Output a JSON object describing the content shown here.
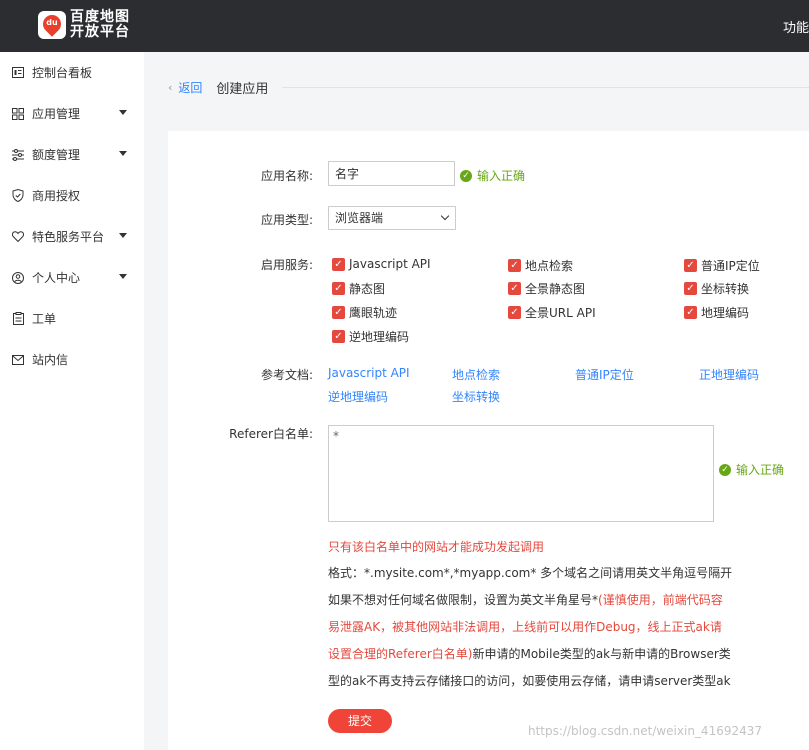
{
  "header": {
    "logo_badge": "du",
    "logo_line1": "百度地图",
    "logo_line2": "开放平台",
    "right_text": "功能"
  },
  "sidebar": {
    "items": [
      {
        "label": "控制台看板",
        "icon": "dashboard-icon",
        "caret": false
      },
      {
        "label": "应用管理",
        "icon": "grid-icon",
        "caret": true
      },
      {
        "label": "额度管理",
        "icon": "sliders-icon",
        "caret": true
      },
      {
        "label": "商用授权",
        "icon": "shield-icon",
        "caret": false
      },
      {
        "label": "特色服务平台",
        "icon": "heart-icon",
        "caret": true
      },
      {
        "label": "个人中心",
        "icon": "user-icon",
        "caret": true
      },
      {
        "label": "工单",
        "icon": "clipboard-icon",
        "caret": false
      },
      {
        "label": "站内信",
        "icon": "mail-icon",
        "caret": false
      }
    ]
  },
  "breadcrumb": {
    "back_label": "返回",
    "title": "创建应用"
  },
  "form": {
    "app_name_label": "应用名称:",
    "app_name_value": "名字",
    "valid_text": "输入正确",
    "app_type_label": "应用类型:",
    "app_type_value": "浏览器端",
    "services_label": "启用服务:",
    "services": [
      "Javascript API",
      "地点检索",
      "普通IP定位",
      "静态图",
      "全景静态图",
      "坐标转换",
      "鹰眼轨迹",
      "全景URL API",
      "地理编码",
      "逆地理编码"
    ],
    "docs_label": "参考文档:",
    "docs": [
      "Javascript API",
      "地点检索",
      "普通IP定位",
      "正地理编码",
      "逆地理编码",
      "坐标转换"
    ],
    "referer_label": "Referer白名单:",
    "referer_value": "*",
    "referer_valid_text": "输入正确",
    "warning": "只有该白名单中的网站才能成功发起调用",
    "format_line1": "格式：*.mysite.com*,*myapp.com* 多个域名之间请用英文半角逗号隔开",
    "format_line2a": "如果不想对任何域名做限制，设置为英文半角星号*",
    "format_line2b": "(谨慎使用，前端代码容",
    "format_line3": "易泄露AK，被其他网站非法调用，上线前可以用作Debug，线上正式ak请",
    "format_line4a": "设置合理的Referer白名单)",
    "format_line4b": "新申请的Mobile类型的ak与新申请的Browser类",
    "format_line5": "型的ak不再支持云存储接口的访问，如要使用云存储，请申请server类型ak",
    "submit_label": "提交"
  },
  "watermark": "https://blog.csdn.net/weixin_41692437",
  "colors": {
    "accent": "#e5483d",
    "link": "#3385ff",
    "valid": "#67a716"
  }
}
